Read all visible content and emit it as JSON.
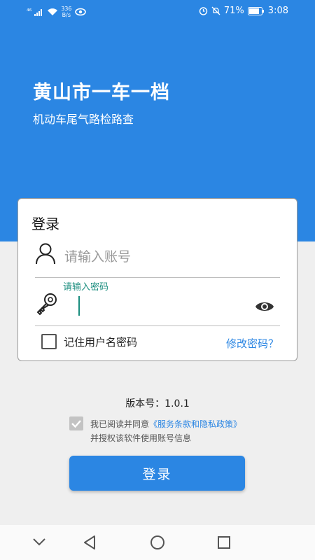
{
  "status_bar": {
    "signal": "⁴⁶",
    "net_speed_value": "336",
    "net_speed_unit": "B/s",
    "battery_percent": "71%",
    "time": "3:08"
  },
  "header": {
    "title": "黄山市一车一档",
    "subtitle": "机动车尾气路检路查"
  },
  "login_card": {
    "title": "登录",
    "account_placeholder": "请输入账号",
    "account_value": "",
    "password_label": "请输入密码",
    "password_value": "",
    "remember_label": "记住用户名密码",
    "remember_checked": false,
    "forgot_link": "修改密码？"
  },
  "footer": {
    "version": "版本号：1.0.1",
    "agree_prefix": "我已阅读并同意",
    "agree_policy": "《服务条款和隐私政策》",
    "agree_line2": "并授权该软件使用账号信息",
    "agree_checked": true,
    "login_button": "登录"
  },
  "colors": {
    "primary": "#2b86e3",
    "accent_teal": "#1a8d7e",
    "page_bg": "#efefef"
  },
  "icons": [
    "user-icon",
    "key-icon",
    "eye-icon",
    "alarm-icon",
    "mute-icon",
    "battery-icon",
    "wifi-icon",
    "back-icon",
    "home-icon",
    "recents-icon",
    "nav-down-icon"
  ]
}
